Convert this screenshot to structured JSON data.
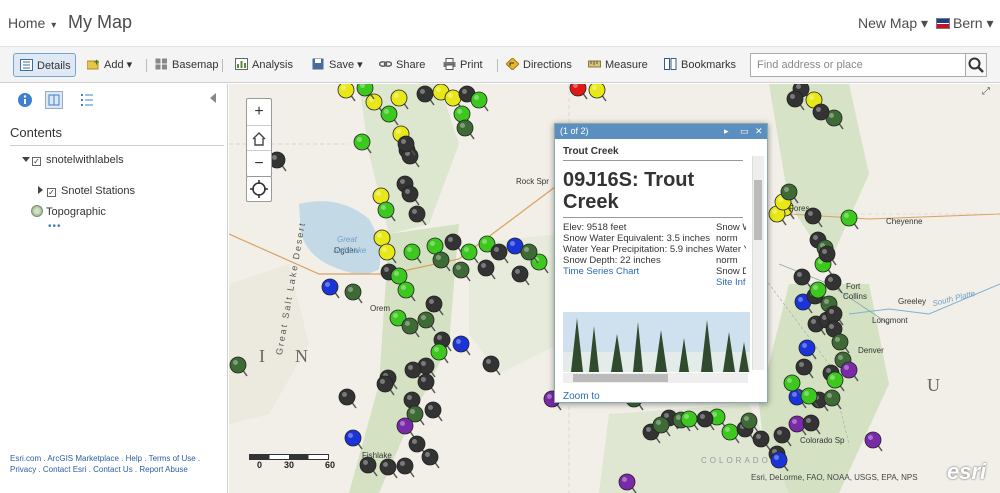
{
  "header": {
    "home_label": "Home",
    "home_caret": "▾",
    "map_title": "My Map",
    "new_map_label": "New Map ▾",
    "user_label": "Bern ▾"
  },
  "toolbar": {
    "details": "Details",
    "add": "Add ▾",
    "basemap": "Basemap",
    "analysis": "Analysis",
    "save": "Save ▾",
    "share": "Share",
    "print": "Print",
    "directions": "Directions",
    "measure": "Measure",
    "bookmarks": "Bookmarks",
    "search_placeholder": "Find address or place"
  },
  "left_panel": {
    "contents_heading": "Contents",
    "layers": [
      {
        "label": "snotelwithlabels",
        "checked": true,
        "expanded": true
      },
      {
        "label": "Snotel Stations",
        "checked": true,
        "expanded": false
      },
      {
        "label": "Topographic"
      }
    ],
    "more_dots": "•••",
    "footer_text": "Esri.com . ArcGIS Marketplace . Help . Terms of Use . Privacy . Contact Esri . Contact Us . Report Abuse"
  },
  "map": {
    "zoom_in": "+",
    "zoom_out": "−",
    "scale_labels": [
      "0",
      "30",
      "60"
    ],
    "attribution": "Esri, DeLorme, FAO, NOAA, USGS, EPA, NPS",
    "logo_text": "esri",
    "labels": {
      "rock_springs": "Rock Spr",
      "ogden": "Ogden",
      "great_salt_lake_1": "Great",
      "great_salt_lake_2": "Salt Lake",
      "desert_vertical": "Great Salt Lake Desert",
      "orem": "Orem",
      "fishlake": "Fishlake",
      "cheyenne": "Cheyenne",
      "fort_collins_1": "Fort",
      "fort_collins_2": "Collins",
      "greeley": "Greeley",
      "south_platte": "South Platte",
      "longmont": "Longmont",
      "denver": "Denver",
      "colorado_springs": "Colorado Sp",
      "colorado": "COLORADO",
      "letter_i": "I",
      "letter_n": "N",
      "letter_u": "U",
      "forest": "Fores"
    },
    "marker_colors": {
      "green": "#3cc81e",
      "dark_green": "#3e6b35",
      "black": "#333333",
      "yellow": "#e8e818",
      "blue": "#1a34d8",
      "purple": "#7a2aa8",
      "red": "#e01818"
    }
  },
  "popup": {
    "paging": "(1 of 2)",
    "controls": {
      "next": "▸",
      "maximize": "▭",
      "close": "✕"
    },
    "subtitle": "Trout Creek",
    "title": "09J16S: Trout Creek",
    "fields_left": [
      "Elev: 9518 feet",
      "Snow Water Equivalent: 3.5 inches",
      "Water Year Precipitation: 5.9 inches",
      "Snow Depth: 22 inches"
    ],
    "fields_right": [
      "Snow W",
      "norm",
      "Water Y",
      "norm",
      "Snow D"
    ],
    "link_left": "Time Series Chart",
    "link_right": "Site Inf",
    "zoom_to": "Zoom to"
  }
}
